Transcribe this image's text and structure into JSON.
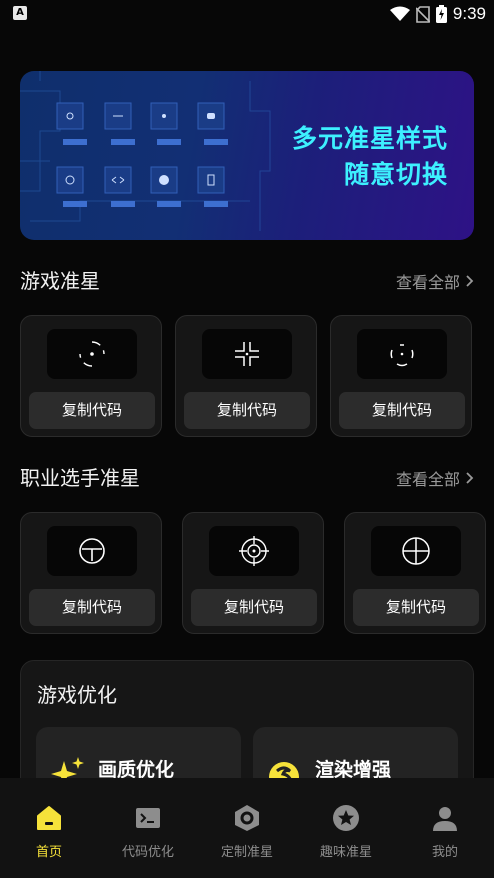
{
  "status_bar": {
    "time": "9:39"
  },
  "banner": {
    "line1": "多元准星样式",
    "line2": "随意切换"
  },
  "sections": {
    "game": {
      "title": "游戏准星",
      "more": "查看全部",
      "cards": [
        {
          "icon": "circle-dot-crosshair-icon",
          "button": "复制代码"
        },
        {
          "icon": "corner-brackets-crosshair-icon",
          "button": "复制代码"
        },
        {
          "icon": "bracket-dot-crosshair-icon",
          "button": "复制代码"
        }
      ]
    },
    "pro": {
      "title": "职业选手准星",
      "more": "查看全部",
      "cards": [
        {
          "icon": "t-circle-crosshair-icon",
          "button": "复制代码"
        },
        {
          "icon": "scope-crosshair-icon",
          "button": "复制代码"
        },
        {
          "icon": "circle-cross-crosshair-icon",
          "button": "复制代码"
        }
      ]
    }
  },
  "optimize": {
    "title": "游戏优化",
    "cards": [
      {
        "label": "画质优化",
        "icon": "sparkle-icon"
      },
      {
        "label": "渲染增强",
        "icon": "swirl-icon"
      }
    ]
  },
  "nav": [
    {
      "label": "首页",
      "icon": "home-icon",
      "active": true
    },
    {
      "label": "代码优化",
      "icon": "terminal-icon",
      "active": false
    },
    {
      "label": "定制准星",
      "icon": "hexagon-icon",
      "active": false
    },
    {
      "label": "趣味准星",
      "icon": "star-badge-icon",
      "active": false
    },
    {
      "label": "我的",
      "icon": "person-icon",
      "active": false
    }
  ],
  "colors": {
    "accent": "#f6e23a",
    "banner_text": "#3df0ff",
    "background": "#070707",
    "card": "#161616"
  }
}
